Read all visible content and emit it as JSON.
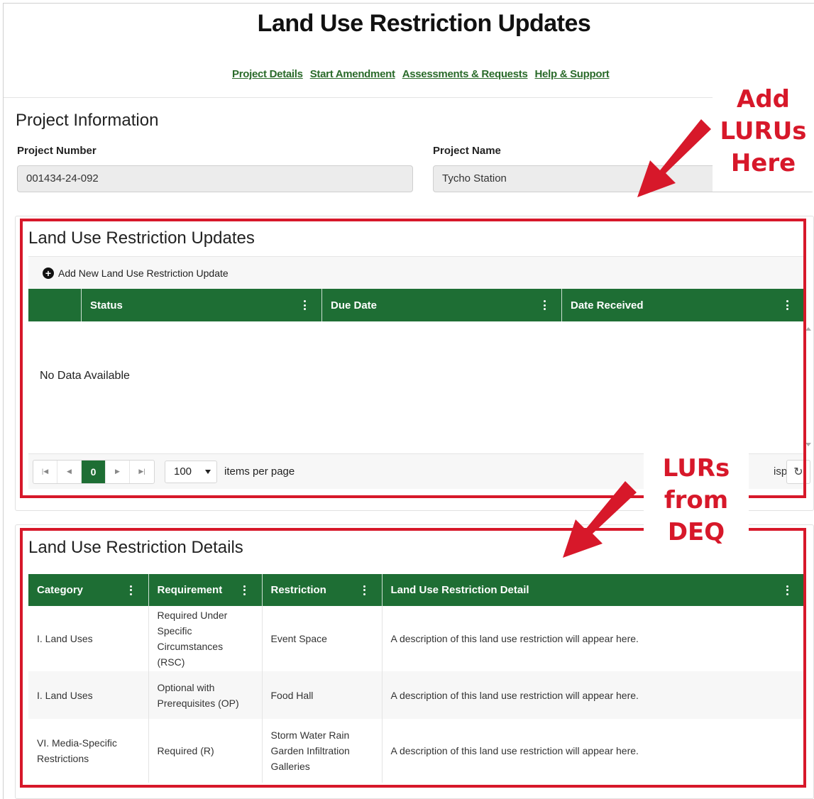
{
  "page": {
    "title": "Land Use Restriction Updates"
  },
  "nav": [
    "Project Details",
    "Start Amendment",
    "Assessments & Requests",
    "Help & Support"
  ],
  "project_info": {
    "heading": "Project Information",
    "project_number_label": "Project Number",
    "project_number_value": "001434-24-092",
    "project_name_label": "Project Name",
    "project_name_value": "Tycho Station"
  },
  "updates": {
    "heading": "Land Use Restriction Updates",
    "add_label": "Add New Land Use Restriction Update",
    "columns": [
      "Status",
      "Due Date",
      "Date Received"
    ],
    "empty_text": "No Data Available",
    "pager": {
      "current_page": "0",
      "page_size": "100",
      "items_per_page_label": "items per page",
      "display_text": "isplay"
    }
  },
  "details": {
    "heading": "Land Use Restriction Details",
    "columns": [
      "Category",
      "Requirement",
      "Restriction",
      "Land Use Restriction Detail"
    ],
    "rows": [
      {
        "category": "I. Land Uses",
        "requirement": "Required Under Specific Circumstances (RSC)",
        "restriction": "Event Space",
        "detail": "A description of this land use restriction will appear here."
      },
      {
        "category": "I. Land Uses",
        "requirement": "Optional with Prerequisites (OP)",
        "restriction": "Food Hall",
        "detail": "A description of this land use restriction will appear here."
      },
      {
        "category": "VI. Media-Specific Restrictions",
        "requirement": "Required (R)",
        "restriction": "Storm Water Rain Garden Infiltration Galleries",
        "detail": "A description of this land use restriction will appear here."
      }
    ]
  },
  "annotations": {
    "callout_1": [
      "Add",
      "LURUs",
      "Here"
    ],
    "callout_2": [
      "LURs",
      "from",
      "DEQ"
    ],
    "color": "#d7182a"
  },
  "colors": {
    "header_green": "#1e6e34",
    "link_green": "#2b6b2b"
  }
}
